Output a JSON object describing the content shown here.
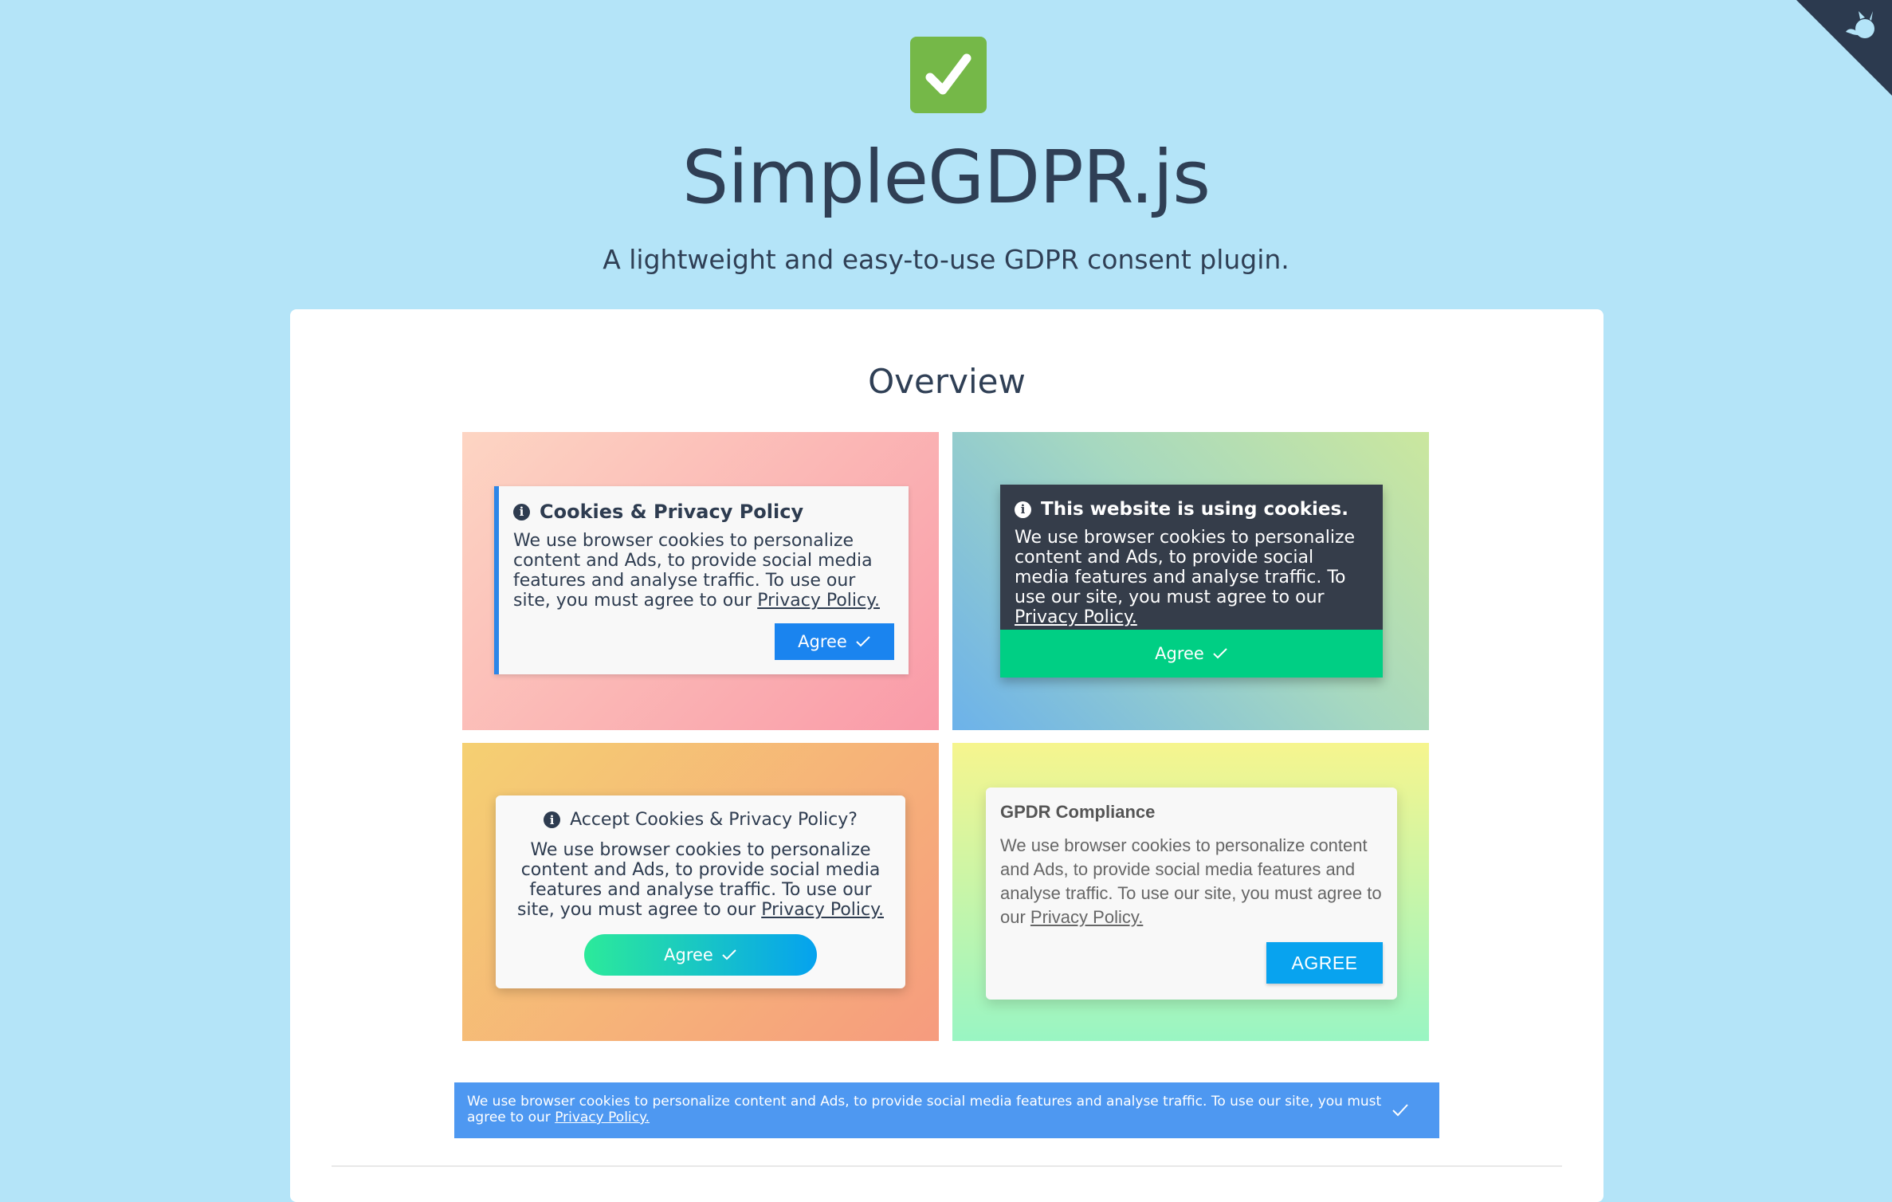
{
  "header": {
    "title": "SimpleGDPR.js",
    "subtitle": "A lightweight and easy-to-use GDPR consent plugin."
  },
  "overview": {
    "title": "Overview",
    "cards": [
      {
        "title": "Cookies & Privacy Policy",
        "body": "We use browser cookies to personalize content and Ads, to provide social media features and analyse traffic. To use our site, you must agree to our",
        "link": "Privacy Policy.",
        "button": "Agree"
      },
      {
        "title": "This website is using cookies.",
        "body": "We use browser cookies to personalize content and Ads, to provide social media features and analyse traffic. To use our site, you must agree to our",
        "link": "Privacy Policy.",
        "button": "Agree"
      },
      {
        "title": "Accept Cookies & Privacy Policy?",
        "body": "We use browser cookies to personalize content and Ads, to provide social media features and analyse traffic. To use our site, you must agree to our",
        "link": "Privacy Policy.",
        "button": "Agree"
      },
      {
        "title": "GPDR Compliance",
        "body": "We use browser cookies to personalize content and Ads, to provide social media features and analyse traffic. To use our site, you must agree to our",
        "link": "Privacy Policy.",
        "button": "AGREE"
      }
    ],
    "bar": {
      "body": "We use browser cookies to personalize content and Ads, to provide social media features and analyse traffic. To use our site, you must agree to our",
      "link": "Privacy Policy."
    }
  },
  "icons": {
    "hero": "check-mark-icon",
    "corner": "github-octocat-icon",
    "info": "info-icon"
  },
  "colors": {
    "background": "#b4e4f8",
    "hero_icon": "#75b848",
    "card1_button": "#1a84ef",
    "card2_button": "#00cf84",
    "card4_button": "#08a3ef",
    "bar": "#4e98f1"
  }
}
